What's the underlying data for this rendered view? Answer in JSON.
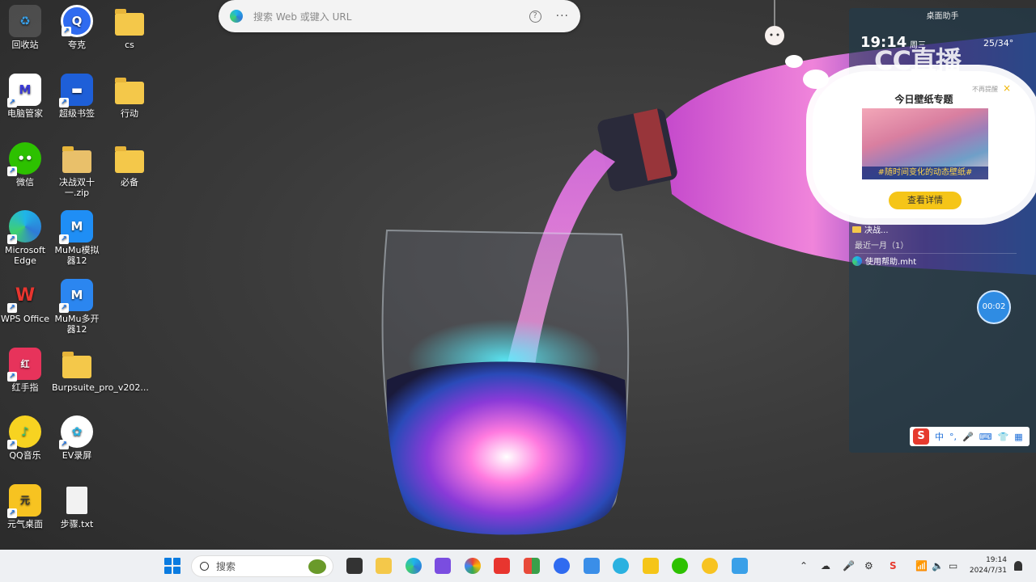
{
  "browser_search": {
    "placeholder": "搜索 Web 或键入 URL",
    "help_glyph": "?",
    "more_glyph": "···"
  },
  "desktop_icons": [
    {
      "label": "回收站",
      "icon": "recycle-bin-icon",
      "color": "#3aa0e8"
    },
    {
      "label": "夸克",
      "icon": "quark-browser-icon",
      "color": "#2f6bf0"
    },
    {
      "label": "cs",
      "icon": "folder-icon",
      "color": "#f4c84a"
    },
    {
      "label": "电脑管家",
      "icon": "pc-manager-icon",
      "color": "#ffffff"
    },
    {
      "label": "超级书签",
      "icon": "bookmark-icon",
      "color": "#1e5fd8"
    },
    {
      "label": "行动",
      "icon": "folder-icon",
      "color": "#f4c84a"
    },
    {
      "label": "微信",
      "icon": "wechat-icon",
      "color": "#2dc100"
    },
    {
      "label": "决战双十一.zip",
      "icon": "zip-folder-icon",
      "color": "#f4c84a"
    },
    {
      "label": "必备",
      "icon": "folder-icon",
      "color": "#f4c84a"
    },
    {
      "label": "Microsoft Edge",
      "icon": "edge-icon",
      "color": "#1fa5e0"
    },
    {
      "label": "MuMu模拟器12",
      "icon": "mumu-emulator-icon",
      "color": "#1f8ef5"
    },
    {
      "label": "WPS Office",
      "icon": "wps-icon",
      "color": "#e8352f"
    },
    {
      "label": "MuMu多开器12",
      "icon": "mumu-multi-icon",
      "color": "#2b86f0"
    },
    {
      "label": "红手指",
      "icon": "redfinger-icon",
      "color": "#e7335b"
    },
    {
      "label": "Burpsuite_pro_v202...",
      "icon": "folder-icon",
      "color": "#f4c84a"
    },
    {
      "label": "QQ音乐",
      "icon": "qq-music-icon",
      "color": "#31c27c"
    },
    {
      "label": "EV录屏",
      "icon": "ev-recorder-icon",
      "color": "#2ab1e0"
    },
    {
      "label": "元气桌面",
      "icon": "yuanqi-desktop-icon",
      "color": "#f7c321"
    },
    {
      "label": "步骤.txt",
      "icon": "text-file-icon",
      "color": "#eeeeee"
    }
  ],
  "assistant": {
    "title": "桌面助手",
    "time": "19:14",
    "weekday": "周三",
    "temperature": "25/34°",
    "folder_item": "决战...",
    "recent_header": "最近一月（1）",
    "recent_file": "使用帮助.mht",
    "timer": "00:02",
    "watermark": "CC直播"
  },
  "wallpaper_popup": {
    "dismiss": "不再提醒",
    "close": "×",
    "title": "今日壁纸专题",
    "caption": "#随时间变化的动态壁纸#",
    "button": "查看详情"
  },
  "ime": {
    "logo": "S",
    "mode": "中",
    "punct": "°,"
  },
  "taskbar": {
    "search_label": "搜索",
    "clock_time": "19:14",
    "clock_date": "2024/7/31",
    "apps": [
      {
        "name": "task-view",
        "color": "#333333"
      },
      {
        "name": "file-explorer",
        "color": "#f4c84a"
      },
      {
        "name": "edge",
        "color": "#1fa5e0"
      },
      {
        "name": "app-purple",
        "color": "#7a4de0"
      },
      {
        "name": "chrome",
        "color": "#4285f4"
      },
      {
        "name": "wps",
        "color": "#e8352f"
      },
      {
        "name": "app-grid",
        "color": "#e84a3a"
      },
      {
        "name": "quark",
        "color": "#2f6bf0"
      },
      {
        "name": "app-doc",
        "color": "#3a8ee8"
      },
      {
        "name": "ev-recorder",
        "color": "#2ab1e0"
      },
      {
        "name": "app-q",
        "color": "#f5c518"
      },
      {
        "name": "wechat",
        "color": "#2dc100"
      },
      {
        "name": "qq-music",
        "color": "#f7c321"
      },
      {
        "name": "notepad",
        "color": "#3aa0e8"
      }
    ]
  }
}
